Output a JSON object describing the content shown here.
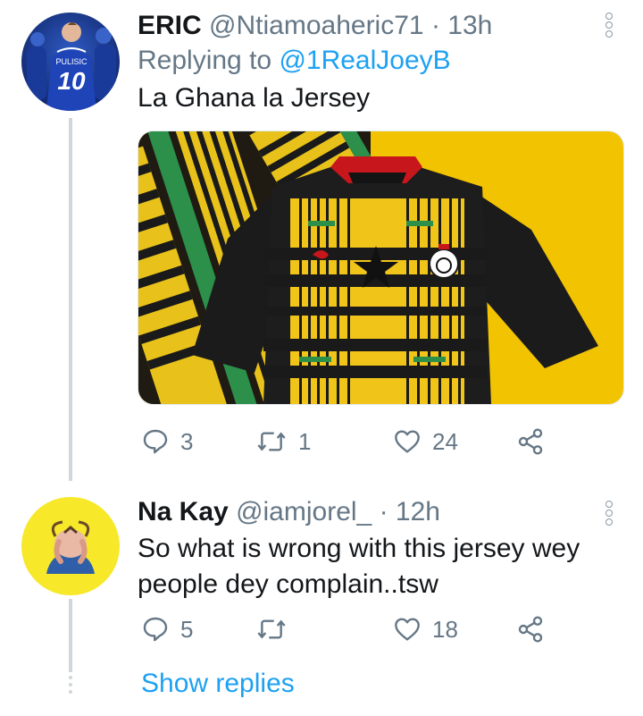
{
  "tweets": [
    {
      "name": "ERIC",
      "handle": "@Ntiamoaheric71",
      "separator": "·",
      "time": "13h",
      "replying_prefix": "Replying to",
      "replying_to": "@1RealJoeyB",
      "text": "La Ghana la Jersey",
      "avatar_number": "10",
      "avatar_name": "PULISIC",
      "replies": "3",
      "retweets": "1",
      "likes": "24"
    },
    {
      "name": "Na Kay",
      "handle": "@iamjorel_",
      "separator": "·",
      "time": "12h",
      "text": "So what is wrong with this jersey wey people dey complain..tsw",
      "replies": "5",
      "retweets": "",
      "likes": "18"
    }
  ],
  "show_replies": "Show replies",
  "colors": {
    "accent": "#1da1f2",
    "muted": "#657786",
    "thread_line": "#cfd6dc"
  }
}
